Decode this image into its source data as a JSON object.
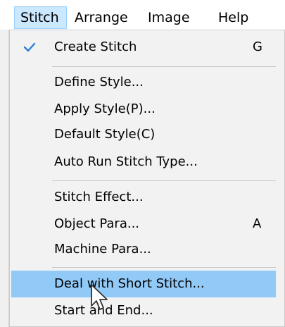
{
  "menubar": {
    "items": [
      {
        "label": "Stitch"
      },
      {
        "label": "Arrange"
      },
      {
        "label": "Image"
      },
      {
        "label": "Help"
      }
    ]
  },
  "menu": {
    "create_stitch": {
      "label": "Create Stitch",
      "shortcut": "G",
      "checked": true
    },
    "define_style": {
      "label": "Define Style..."
    },
    "apply_style": {
      "label": "Apply Style(P)..."
    },
    "default_style": {
      "label": "Default Style(C)"
    },
    "auto_run_stitch_type": {
      "label": "Auto Run Stitch Type..."
    },
    "stitch_effect": {
      "label": "Stitch Effect..."
    },
    "object_para": {
      "label": "Object Para...",
      "shortcut": "A"
    },
    "machine_para": {
      "label": "Machine Para..."
    },
    "deal_with_short_stitch": {
      "label": "Deal with Short Stitch...",
      "highlighted": true
    },
    "start_and_end": {
      "label": "Start and End..."
    }
  },
  "colors": {
    "highlight": "#91c9f7",
    "menubar_active": "#cce8ff",
    "check": "#2a7fd4"
  },
  "icons": {
    "check": "checkmark-icon",
    "cursor": "mouse-pointer-icon"
  }
}
